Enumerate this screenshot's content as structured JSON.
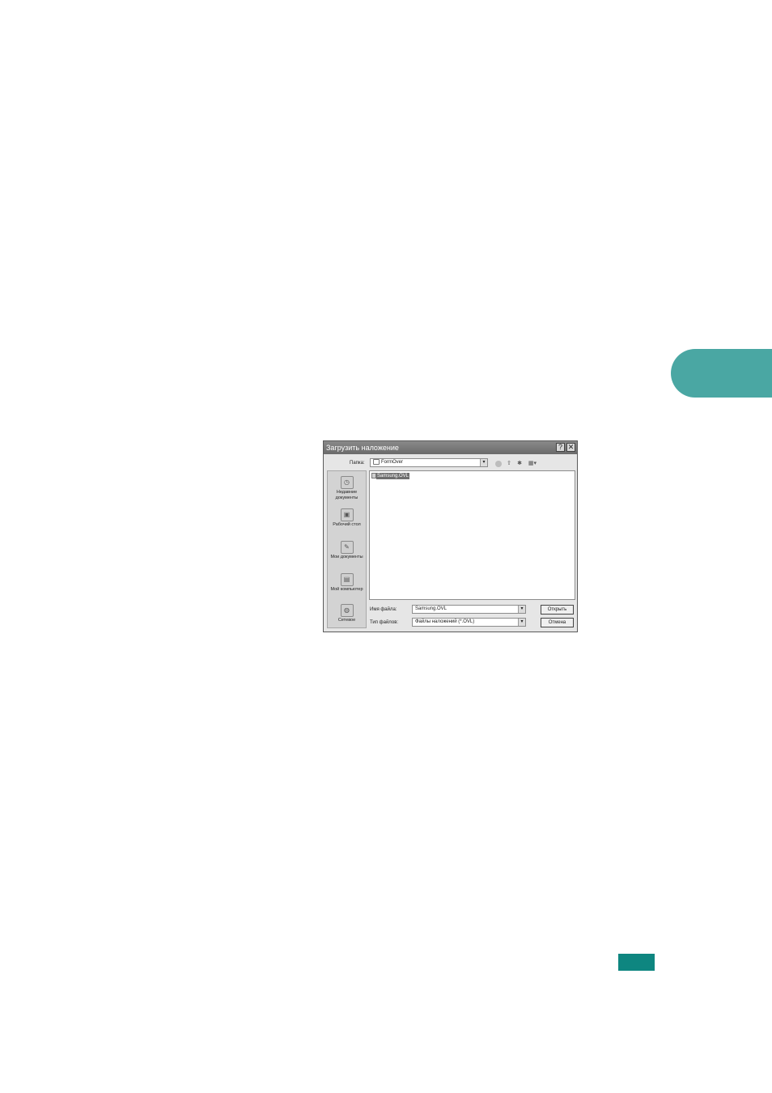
{
  "dialog": {
    "title": "Загрузить наложение",
    "help_label": "?",
    "close_label": "✕",
    "lookin_label": "Папка:",
    "lookin_value": "FormOver",
    "lookin_dropdown": "▾",
    "toolbar_icons": [
      "back-icon",
      "up-folder-icon",
      "new-folder-icon",
      "view-menu-icon"
    ],
    "places": [
      {
        "label": "Недавние документы",
        "icon": "recent-documents-icon"
      },
      {
        "label": "Рабочий стол",
        "icon": "desktop-icon"
      },
      {
        "label": "Мои документы",
        "icon": "my-documents-icon"
      },
      {
        "label": "Мой компьютер",
        "icon": "my-computer-icon"
      },
      {
        "label": "Сетевое",
        "icon": "network-icon"
      }
    ],
    "files": [
      {
        "name": "Samsung.OVL",
        "selected": true
      }
    ],
    "filename_label": "Имя файла:",
    "filename_value": "Samsung.OVL",
    "filetype_label": "Тип файлов:",
    "filetype_value": "Файлы наложений (*.OVL)",
    "open_button": "Открыть",
    "cancel_button": "Отмена"
  },
  "colors": {
    "tab_marker": "#4aa7a3",
    "page_marker": "#0e8680"
  }
}
